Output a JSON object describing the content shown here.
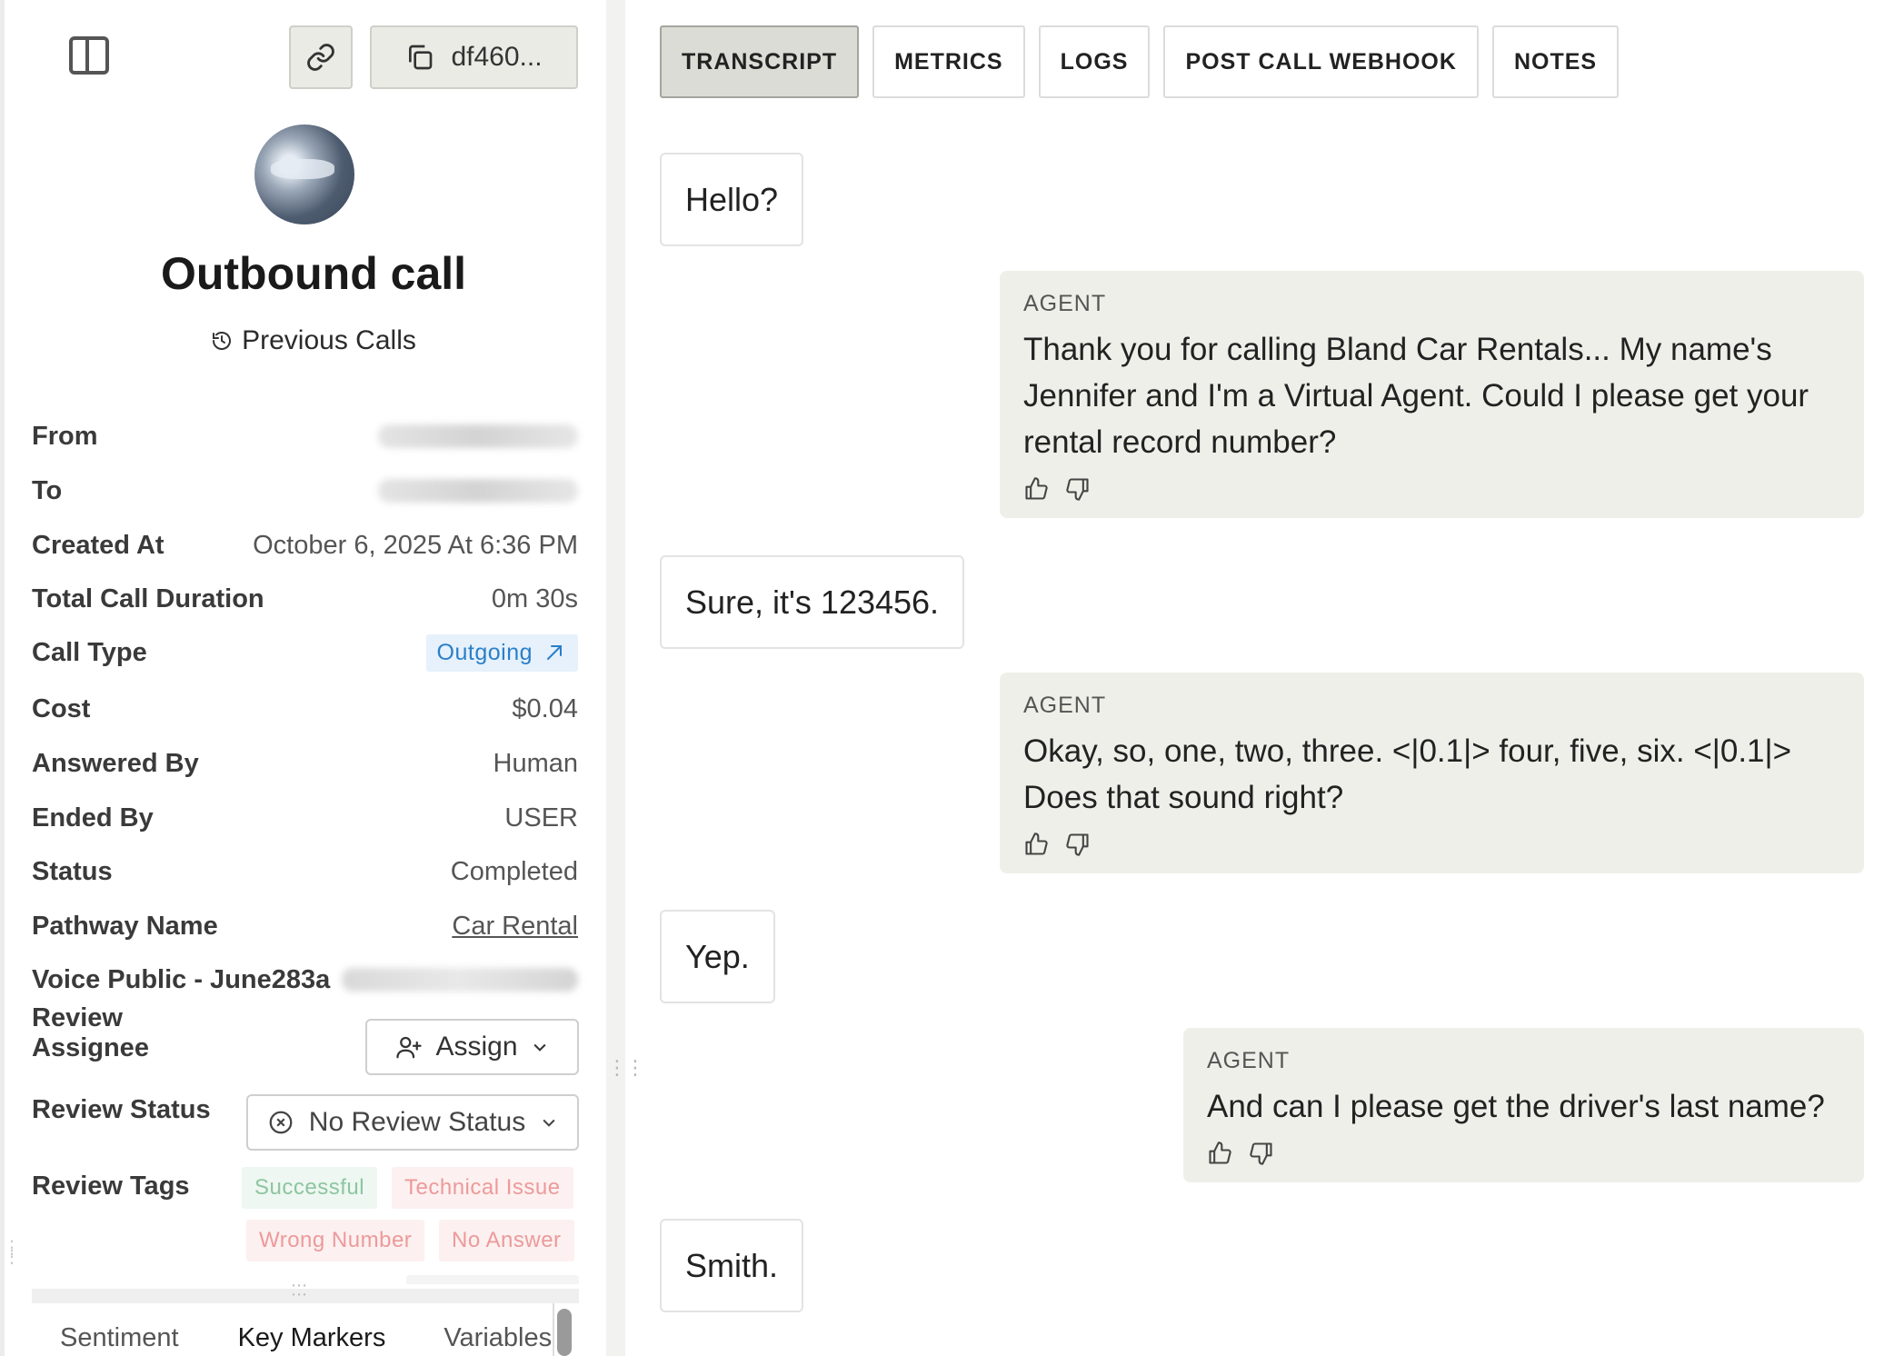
{
  "left": {
    "copy_id_label": "df460...",
    "title": "Outbound call",
    "previous_calls_label": "Previous Calls",
    "details": {
      "from_label": "From",
      "to_label": "To",
      "created_at_label": "Created At",
      "created_at_value": "October 6, 2025 At 6:36 PM",
      "duration_label": "Total Call Duration",
      "duration_value": "0m 30s",
      "call_type_label": "Call Type",
      "call_type_value": "Outgoing",
      "cost_label": "Cost",
      "cost_value": "$0.04",
      "answered_by_label": "Answered By",
      "answered_by_value": "Human",
      "ended_by_label": "Ended By",
      "ended_by_value": "USER",
      "status_label": "Status",
      "status_value": "Completed",
      "pathway_label": "Pathway Name",
      "pathway_value": "Car Rental",
      "voice_label": "Voice  Public - June283a",
      "review_assignee_label": "Review Assignee",
      "assign_label": "Assign",
      "review_status_label": "Review Status",
      "review_status_value": "No Review Status",
      "review_tags_label": "Review Tags"
    },
    "tags": [
      "Successful",
      "Technical Issue",
      "Wrong Number",
      "No Answer"
    ],
    "bottom_tabs": [
      "Sentiment",
      "Key Markers",
      "Variables"
    ]
  },
  "tabs": [
    "TRANSCRIPT",
    "METRICS",
    "LOGS",
    "POST CALL WEBHOOK",
    "NOTES"
  ],
  "transcript": {
    "agent_label": "AGENT",
    "m1": "Hello?",
    "m2": "Thank you for calling Bland Car Rentals... My name's Jennifer and I'm a Virtual Agent. Could I please get your rental record number?",
    "m3": "Sure, it's 123456.",
    "m4": "Okay, so, one, two, three. <|0.1|> four, five, six. <|0.1|> Does that sound right?",
    "m5": "Yep.",
    "m6": "And can I please get the driver's last name?",
    "m7": "Smith."
  },
  "colors": {
    "active_tab_bg": "#dcdcd6",
    "agent_bubble_bg": "#efefe9",
    "outgoing_badge": "#2a7fc9",
    "tag_green": "#8dc5a1",
    "tag_red": "#ec9a9a"
  }
}
